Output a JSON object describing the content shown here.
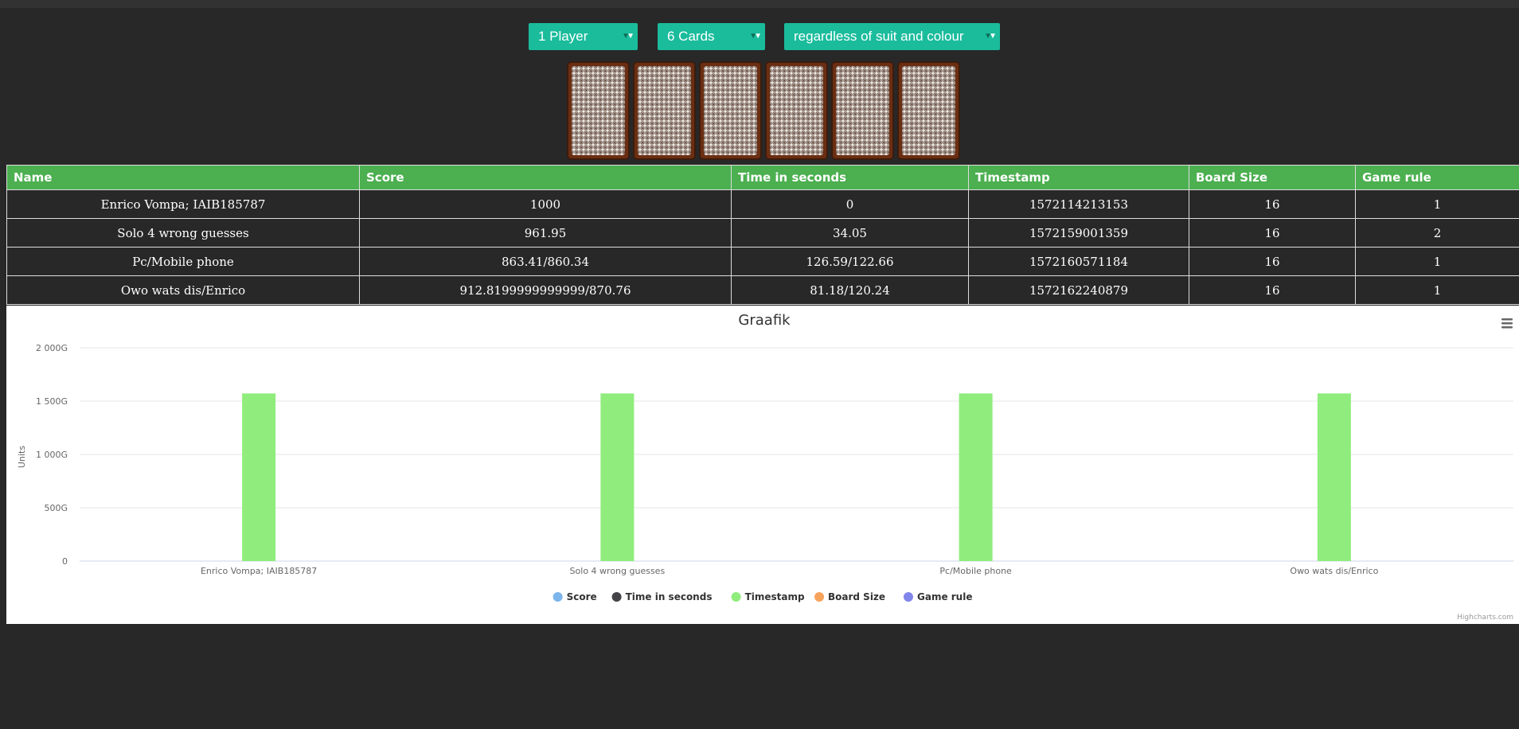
{
  "controls": {
    "players": "1 Player",
    "cards": "6 Cards",
    "rule": "regardless of suit and colour"
  },
  "table": {
    "headers": [
      "Name",
      "Score",
      "Time in seconds",
      "Timestamp",
      "Board Size",
      "Game rule"
    ],
    "rows": [
      [
        "Enrico Vompa; IAIB185787",
        "1000",
        "0",
        "1572114213153",
        "16",
        "1"
      ],
      [
        "Solo 4 wrong guesses",
        "961.95",
        "34.05",
        "1572159001359",
        "16",
        "2"
      ],
      [
        "Pc/Mobile phone",
        "863.41/860.34",
        "126.59/122.66",
        "1572160571184",
        "16",
        "1"
      ],
      [
        "Owo wats dis/Enrico",
        "912.8199999999999/870.76",
        "81.18/120.24",
        "1572162240879",
        "16",
        "1"
      ]
    ]
  },
  "chart_data": {
    "type": "bar",
    "title": "Graafik",
    "xlabel": "",
    "ylabel": "Units",
    "categories": [
      "Enrico Vompa; IAIB185787",
      "Solo 4 wrong guesses",
      "Pc/Mobile phone",
      "Owo wats dis/Enrico"
    ],
    "ylim": [
      0,
      2000000000000
    ],
    "yticks": [
      0,
      500000000000,
      1000000000000,
      1500000000000,
      2000000000000
    ],
    "ytick_labels": [
      "0",
      "500G",
      "1 000G",
      "1 500G",
      "2 000G"
    ],
    "grid": true,
    "legend_position": "bottom-center",
    "series": [
      {
        "name": "Score",
        "color": "#7cb5ec",
        "values": [
          1000,
          961.95,
          null,
          null
        ]
      },
      {
        "name": "Time in seconds",
        "color": "#434348",
        "values": [
          0,
          34.05,
          null,
          null
        ]
      },
      {
        "name": "Timestamp",
        "color": "#90ed7d",
        "values": [
          1572114213153,
          1572159001359,
          1572160571184,
          1572162240879
        ]
      },
      {
        "name": "Board Size",
        "color": "#f7a35c",
        "values": [
          16,
          16,
          16,
          16
        ]
      },
      {
        "name": "Game rule",
        "color": "#8085e9",
        "values": [
          1,
          2,
          1,
          1
        ]
      }
    ],
    "credits": "Highcharts.com",
    "menu_icon": "hamburger-menu-icon"
  }
}
